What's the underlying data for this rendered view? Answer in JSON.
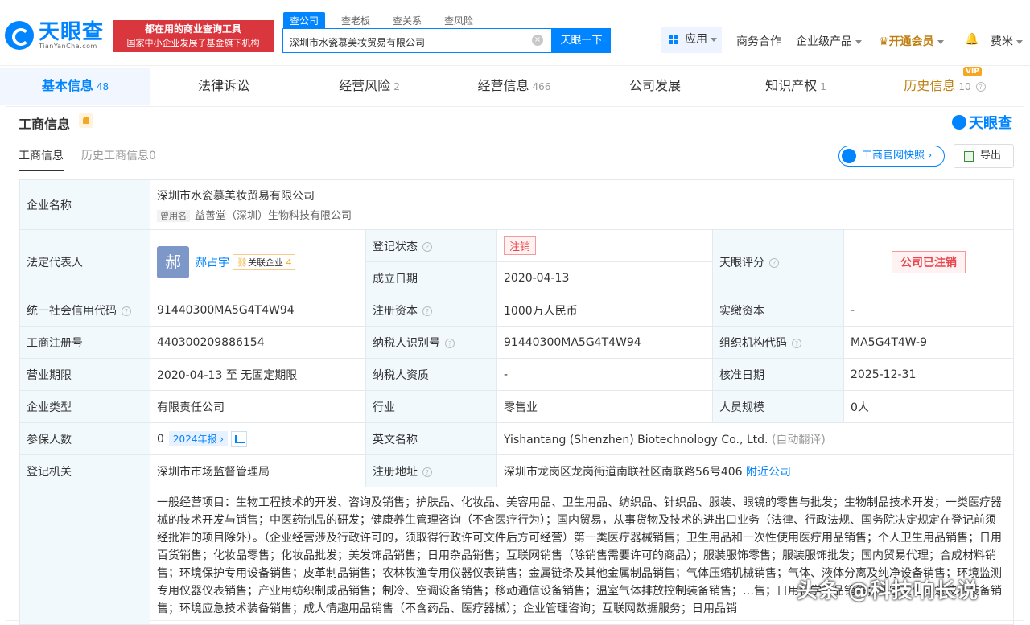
{
  "header": {
    "logo_cn": "天眼查",
    "logo_en": "TianYanCha.com",
    "promo_line1": "都在用的商业查询工具",
    "promo_line2": "国家中小企业发展子基金旗下机构",
    "search_tabs": [
      "查公司",
      "查老板",
      "查关系",
      "查风险"
    ],
    "search_value": "深圳市水瓷慕美妆贸易有限公司",
    "search_button": "天眼一下",
    "nav": {
      "apps": "应用",
      "business": "商务合作",
      "enterprise": "企业级产品",
      "vip": "开通会员",
      "user": "费米"
    }
  },
  "tabs": [
    {
      "label": "基本信息",
      "count": "48"
    },
    {
      "label": "法律诉讼",
      "count": ""
    },
    {
      "label": "经营风险",
      "count": "2"
    },
    {
      "label": "经营信息",
      "count": "466"
    },
    {
      "label": "公司发展",
      "count": ""
    },
    {
      "label": "知识产权",
      "count": "1"
    },
    {
      "label": "历史信息",
      "count": "10"
    }
  ],
  "vip_badge": "VIP",
  "section": {
    "title": "工商信息",
    "logo": "天眼查",
    "subtabs": [
      "工商信息",
      "历史工商信息0"
    ],
    "gs_button": "工商官网快照",
    "export_button": "导出"
  },
  "info": {
    "company_name_label": "企业名称",
    "company_name": "深圳市水瓷慕美妆贸易有限公司",
    "former_tag": "曾用名",
    "former_name": "益善堂（深圳）生物科技有限公司",
    "legal_rep_label": "法定代表人",
    "avatar_char": "郝",
    "legal_rep": "郝占宇",
    "related_label": "关联企业",
    "related_count": "4",
    "reg_status_label": "登记状态",
    "reg_status": "注销",
    "found_date_label": "成立日期",
    "found_date": "2020-04-13",
    "rating_label": "天眼评分",
    "rating": "公司已注销",
    "credit_code_label": "统一社会信用代码",
    "credit_code": "91440300MA5G4T4W94",
    "reg_capital_label": "注册资本",
    "reg_capital": "1000万人民币",
    "paid_capital_label": "实缴资本",
    "paid_capital": "-",
    "reg_no_label": "工商注册号",
    "reg_no": "440300209886154",
    "taxpayer_id_label": "纳税人识别号",
    "taxpayer_id": "91440300MA5G4T4W94",
    "org_code_label": "组织机构代码",
    "org_code": "MA5G4T4W-9",
    "term_label": "营业期限",
    "term": "2020-04-13 至 无固定期限",
    "taxpayer_qual_label": "纳税人资质",
    "taxpayer_qual": "-",
    "approve_date_label": "核准日期",
    "approve_date": "2025-12-31",
    "type_label": "企业类型",
    "type": "有限责任公司",
    "industry_label": "行业",
    "industry": "零售业",
    "staff_label": "人员规模",
    "staff": "0人",
    "insured_label": "参保人数",
    "insured": "0",
    "year_report": "2024年报",
    "en_name_label": "英文名称",
    "en_name": "Yishantang (Shenzhen) Biotechnology Co., Ltd.",
    "auto_translate": "(自动翻译)",
    "authority_label": "登记机关",
    "authority": "深圳市市场监督管理局",
    "address_label": "注册地址",
    "address": "深圳市龙岗区龙岗街道南联社区南联路56号406",
    "nearby": "附近公司",
    "scope": "一般经营项目：生物工程技术的开发、咨询及销售；护肤品、化妆品、美容用品、卫生用品、纺织品、针织品、服装、眼镜的零售与批发；生物制品技术开发；一类医疗器械的技术开发与销售；中医药制品的研发；健康养生管理咨询（不含医疗行为）；国内贸易，从事货物及技术的进出口业务（法律、行政法规、国务院决定规定在登记前须经批准的项目除外）。（企业经营涉及行政许可的，须取得行政许可文件后方可经营）第一类医疗器械销售；卫生用品和一次性使用医疗用品销售；个人卫生用品销售；日用百货销售；化妆品零售；化妆品批发；美发饰品销售；日用杂品销售；互联网销售（除销售需要许可的商品）；服装服饰零售；服装服饰批发；国内贸易代理；合成材料销售；环境保护专用设备销售；皮革制品销售；农林牧渔专用仪器仪表销售；金属链条及其他金属制品销售；气体压缩机械销售；气体、液体分离及纯净设备销售；环境监测专用仪器仪表销售；产业用纺织制成品销售；制冷、空调设备销售；移动通信设备销售；温室气体排放控制装备销售；…售；日用化学产品销售；数字文化创意技术装备销售；环境应急技术装备销售；成人情趣用品销售（不含药品、医疗器械）；企业管理咨询；互联网数据服务；日用品销"
  },
  "watermark": "头条 @科技响长说"
}
